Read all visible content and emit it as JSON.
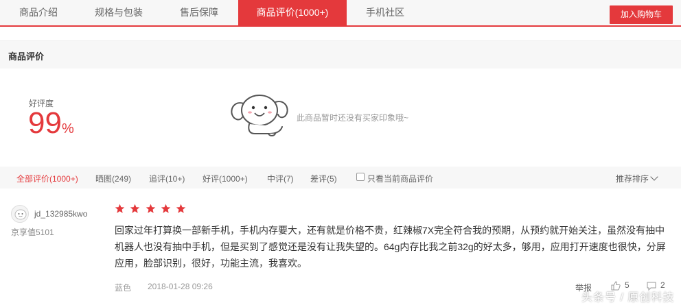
{
  "tabs": [
    {
      "label": "商品介绍",
      "active": false
    },
    {
      "label": "规格与包装",
      "active": false
    },
    {
      "label": "售后保障",
      "active": false
    },
    {
      "label": "商品评价(1000+)",
      "active": true
    },
    {
      "label": "手机社区",
      "active": false
    }
  ],
  "cart_button": "加入购物车",
  "section_title": "商品评价",
  "rating": {
    "label": "好评度",
    "value": "99",
    "unit": "%"
  },
  "no_impression_text": "此商品暂时还没有买家印象哦~",
  "filters": [
    {
      "label": "全部评价(1000+)",
      "active": true
    },
    {
      "label": "晒图(249)",
      "active": false
    },
    {
      "label": "追评(10+)",
      "active": false
    },
    {
      "label": "好评(1000+)",
      "active": false
    },
    {
      "label": "中评(7)",
      "active": false
    },
    {
      "label": "差评(5)",
      "active": false
    }
  ],
  "only_current_label": "只看当前商品评价",
  "sort_label": "推荐排序",
  "review": {
    "username": "jd_132985kwo",
    "user_level": "京享值5101",
    "stars": 5,
    "text": "回家过年打算换一部新手机，手机内存要大，还有就是价格不贵，红辣椒7X完全符合我的预期，从预约就开始关注，虽然没有抽中机器人也没有抽中手机，但是买到了感觉还是没有让我失望的。64g内存比我之前32g的好太多，够用，应用打开速度也很快，分屏应用，脸部识别，很好，功能主流，我喜欢。",
    "spec": "蓝色",
    "date": "2018-01-28 09:26",
    "report_label": "举报",
    "likes": "5",
    "replies": "2"
  },
  "watermark": "头条号 / 原创科技",
  "colors": {
    "accent": "#e4393c",
    "bar_bg": "#f7f7f7"
  }
}
